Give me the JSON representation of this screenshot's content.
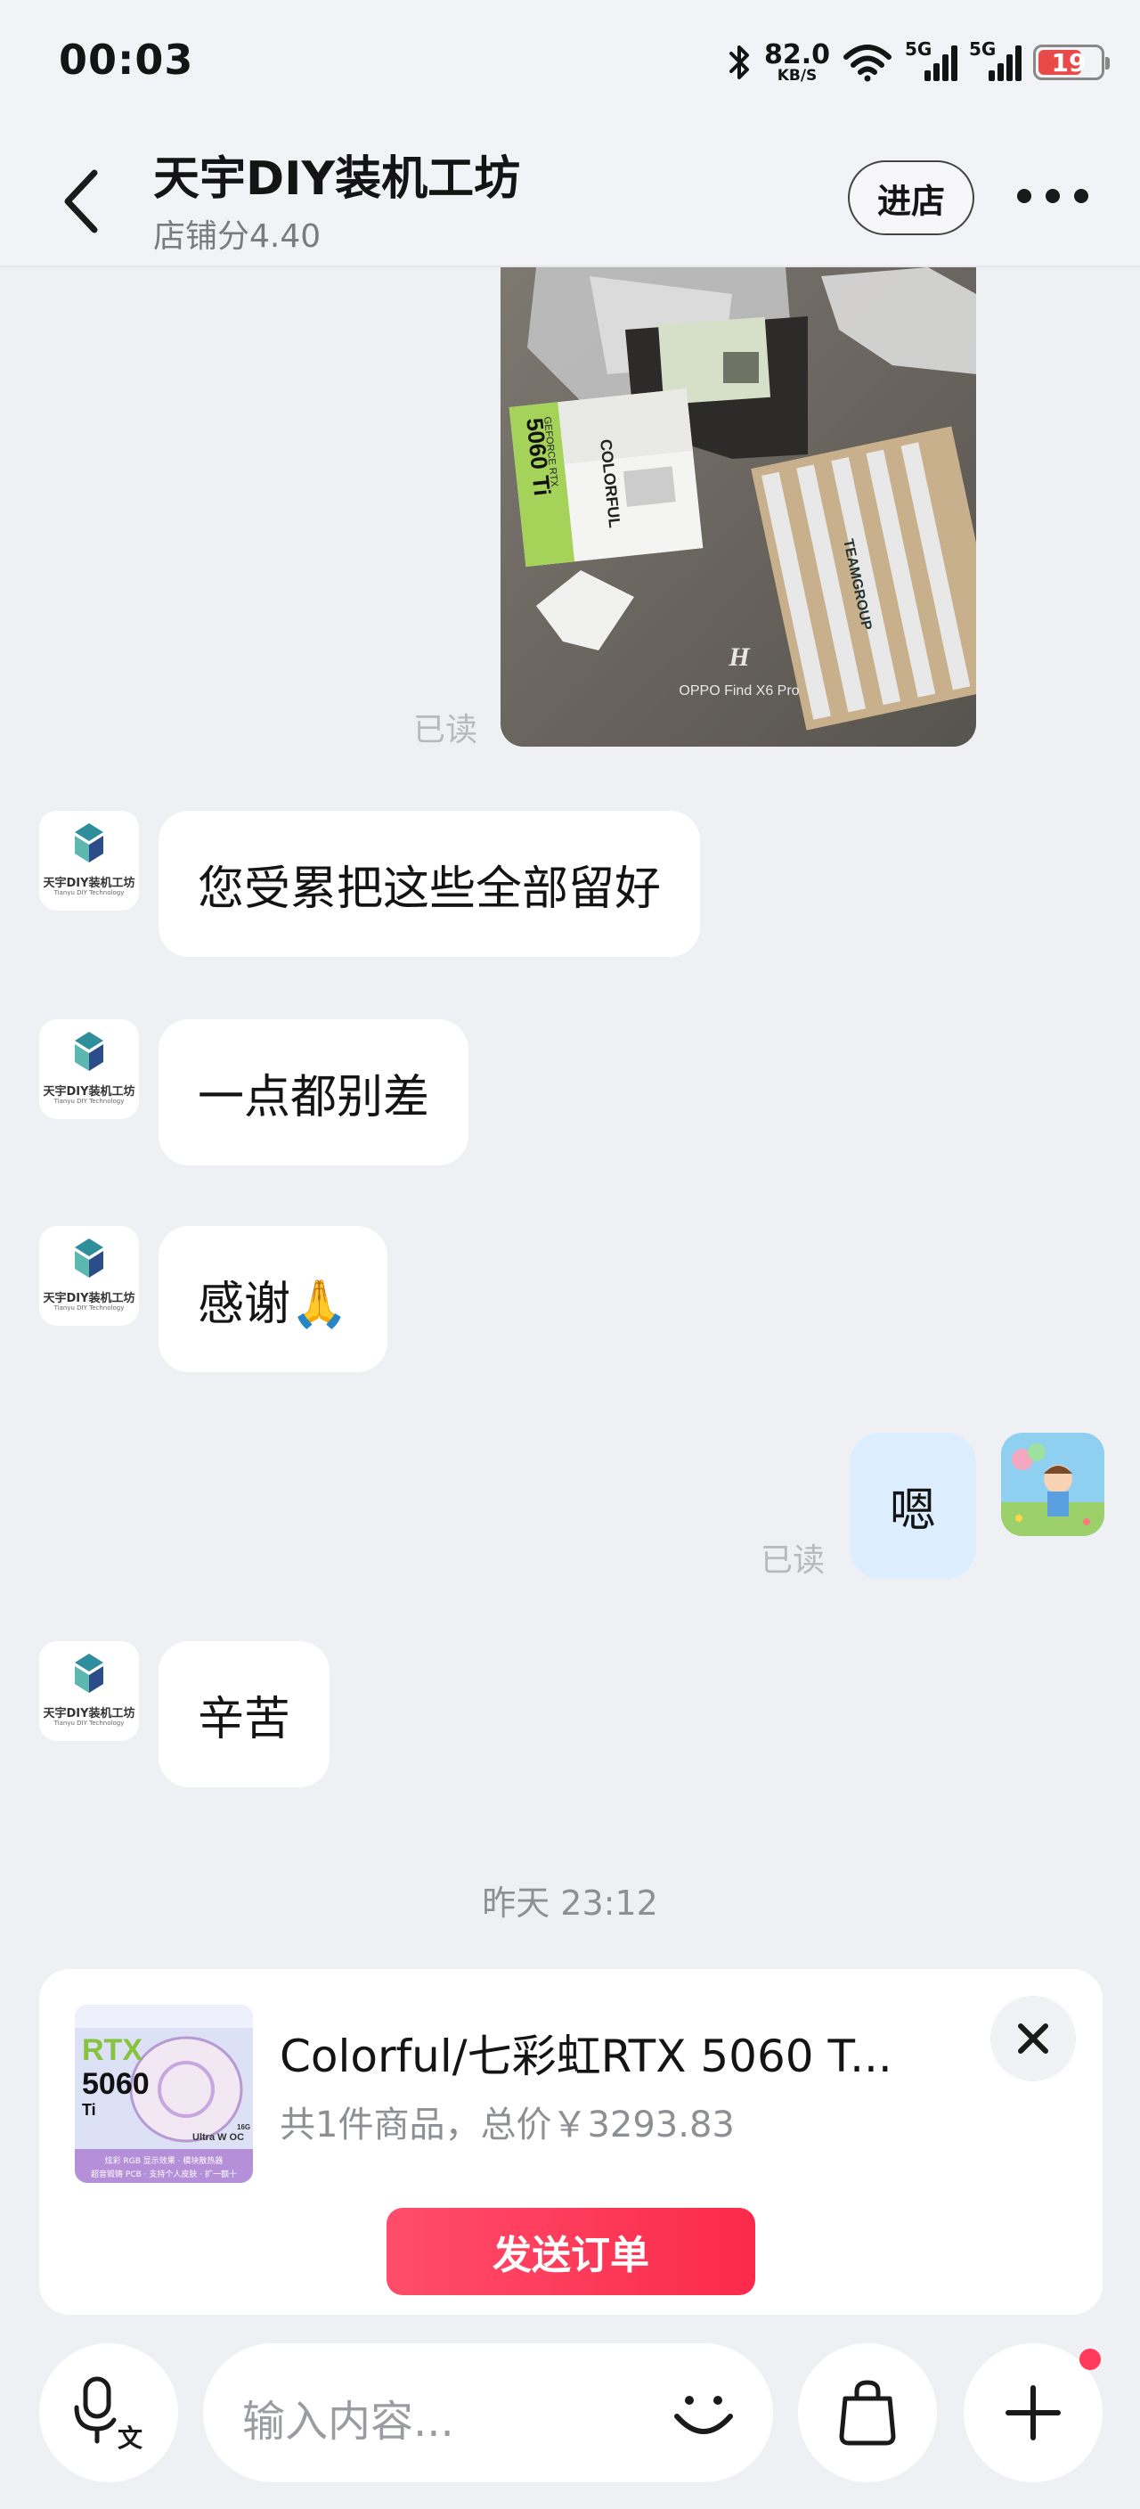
{
  "status_bar": {
    "time": "00:03",
    "net_speed_value": "82.0",
    "net_speed_unit": "KB/S",
    "signal_1_label": "5G",
    "signal_2_label": "5G",
    "battery_level": "19",
    "icons": [
      "bluetooth-icon",
      "wifi-icon",
      "signal-icon",
      "battery-icon"
    ]
  },
  "header": {
    "shop_name": "天宇DIY装机工坊",
    "shop_score": "店铺分4.40",
    "visit_button": "进店"
  },
  "photo": {
    "watermark_line": "OPPO Find X6 Pro",
    "box_model": "5060 Ti",
    "box_brand": "COLORFUL",
    "box_tag": "GEFORCE RTX",
    "package_brand": "TEAMGROUP"
  },
  "shop_logo": {
    "text": "天宇DIY装机工坊",
    "subtext": "Tianyu DIY Technology"
  },
  "messages": [
    {
      "side": "shop",
      "text": "您受累把这些全部留好"
    },
    {
      "side": "shop",
      "text": "一点都别差"
    },
    {
      "side": "shop",
      "text": "感谢🙏"
    },
    {
      "side": "me",
      "text": "嗯"
    },
    {
      "side": "shop",
      "text": "辛苦"
    }
  ],
  "read_labels": [
    "已读",
    "已读"
  ],
  "timestamp": "昨天 23:12",
  "order_card": {
    "title": "Colorful/七彩虹RTX 5060 T...",
    "summary": "共1件商品，总价￥3293.83",
    "send_button": "发送订单",
    "thumb": {
      "line1": "RTX",
      "line2": "5060",
      "line3": "Ti",
      "variant": "Ultra W OC",
      "vram": "16G",
      "features_1": "炫彩 RGB 显示效果 · 模块散热器",
      "features_2": "超音锻铸 PCB · 支持个人皮肤 · 扩一额十"
    }
  },
  "input_bar": {
    "placeholder": "输入内容..."
  },
  "colors": {
    "background": "#eff0f4",
    "bubble_other": "#ffffff",
    "bubble_me": "#dceeff",
    "accent": "#fb2a4a"
  }
}
